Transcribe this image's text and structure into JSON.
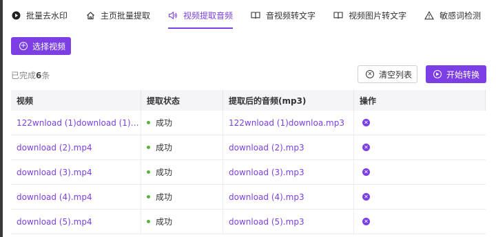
{
  "tabs": [
    {
      "label": "批量去水印",
      "icon": "play-circle-icon",
      "active": false
    },
    {
      "label": "主页批量提取",
      "icon": "home-icon",
      "active": false
    },
    {
      "label": "视频提取音频",
      "icon": "speaker-icon",
      "active": true
    },
    {
      "label": "音视频转文字",
      "icon": "book-icon",
      "active": false
    },
    {
      "label": "视频图片转文字",
      "icon": "book-icon",
      "active": false
    },
    {
      "label": "敏感词检测",
      "icon": "warning-icon",
      "active": false
    }
  ],
  "toolbar": {
    "select_video_label": "选择视频",
    "done_prefix": "已完成",
    "done_count": "6",
    "done_suffix": "条",
    "clear_label": "清空列表",
    "start_label": "开始转换"
  },
  "table": {
    "headers": [
      "视频",
      "提取状态",
      "提取后的音频(mp3)",
      "操作"
    ],
    "rows": [
      {
        "video": "122wnload (1)download (1)dow...",
        "status": "成功",
        "audio": "122wnload (1)downloa.mp3"
      },
      {
        "video": "download (2).mp4",
        "status": "成功",
        "audio": "download (2).mp3"
      },
      {
        "video": "download (3).mp4",
        "status": "成功",
        "audio": "download (3).mp3"
      },
      {
        "video": "download (4).mp4",
        "status": "成功",
        "audio": "download (4).mp3"
      },
      {
        "video": "download (5).mp4",
        "status": "成功",
        "audio": "download (5).mp3"
      }
    ]
  },
  "colors": {
    "accent": "#7b3fe4",
    "success": "#58b33a"
  }
}
